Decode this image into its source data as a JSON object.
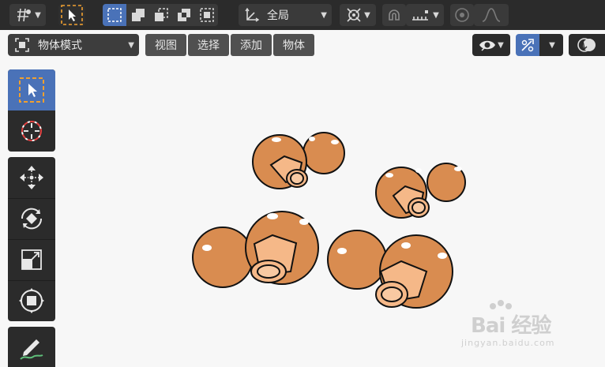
{
  "topbar": {
    "orientation_label": "全局",
    "tools": [
      "transform-pivot",
      "select-tool",
      "select-box",
      "select-extend",
      "select-subtract",
      "select-difference",
      "select-intersect"
    ]
  },
  "header": {
    "mode_label": "物体模式",
    "menus": [
      "视图",
      "选择",
      "添加",
      "物体"
    ]
  },
  "toolbar": {
    "tools": [
      "select-box",
      "cursor",
      "move",
      "rotate",
      "scale",
      "transform",
      "annotate"
    ]
  },
  "watermark": {
    "main": "Bai 经验",
    "sub": "jingyan.baidu.com"
  },
  "colors": {
    "accent": "#4a72b8",
    "active_orange": "#f0a030",
    "mushroom_cap": "#d98c50",
    "mushroom_stem": "#f5b888"
  }
}
